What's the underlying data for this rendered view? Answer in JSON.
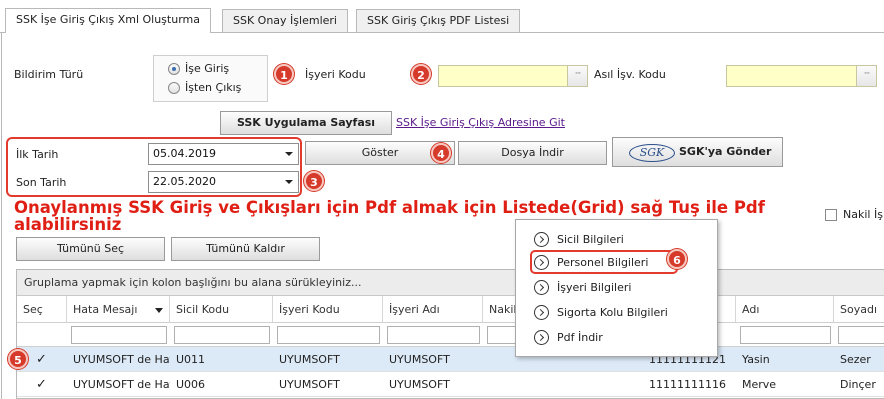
{
  "tabs": [
    {
      "label": "SSK İşe Giriş Çıkış Xml Oluşturma",
      "active": true
    },
    {
      "label": "SSK Onay İşlemleri",
      "active": false
    },
    {
      "label": "SSK Giriş Çıkış PDF Listesi",
      "active": false
    }
  ],
  "form": {
    "bildirim_label": "Bildirim Türü",
    "radio_ise_giris": "İşe Giriş",
    "radio_isten_cikis": "İşten Çıkış",
    "isyeri_kodu_label": "İşyeri Kodu",
    "asil_isv_kodu_label": "Asıl İşv. Kodu",
    "lookup_btn": "···",
    "ssk_page_button": "SSK Uygulama Sayfası",
    "ssk_link": "SSK İşe Giriş Çıkış Adresine Git",
    "ilk_tarih_label": "İlk Tarih",
    "ilk_tarih_value": "05.04.2019",
    "son_tarih_label": "Son Tarih",
    "son_tarih_value": "22.05.2020",
    "goster_button": "Göster",
    "dosya_indir_button": "Dosya İndir",
    "sgk_logo": "SGK",
    "sgk_gonder_button": "SGK'ya Gönder"
  },
  "badges": [
    "1",
    "2",
    "3",
    "4",
    "5",
    "6"
  ],
  "headline": "Onaylanmış SSK Giriş ve Çıkışları için Pdf almak için Listede(Grid) sağ Tuş ile Pdf alabilirsiniz",
  "nakil_checkbox_label": "Nakil İş",
  "select_all_button": "Tümünü Seç",
  "deselect_all_button": "Tümünü Kaldır",
  "grid": {
    "group_hint": "Gruplama yapmak için kolon başlığını bu alana sürükleyiniz...",
    "columns": [
      "Seç",
      "Hata Mesajı",
      "Sicil Kodu",
      "İşyeri Kodu",
      "İşyeri Adı",
      "Nakil",
      "",
      "Adı",
      "Soyadı"
    ],
    "rows": [
      {
        "hata": "UYUMSOFT de Hat",
        "sicil": "U011",
        "isyeri_kodu": "UYUMSOFT",
        "isyeri_adi": "UYUMSOFT",
        "tc": "11111111121",
        "adi": "Yasin",
        "soyadi": "Sezer",
        "selected": true
      },
      {
        "hata": "UYUMSOFT de Hat",
        "sicil": "U006",
        "isyeri_kodu": "UYUMSOFT",
        "isyeri_adi": "UYUMSOFT",
        "tc": "11111111116",
        "adi": "Merve",
        "soyadi": "Dinçer",
        "selected": false
      }
    ]
  },
  "context_menu": {
    "items": [
      "Sicil Bilgileri",
      "Personel Bilgileri",
      "İşyeri Bilgileri",
      "Sigorta Kolu Bilgileri",
      "Pdf İndir"
    ]
  },
  "colors": {
    "accent_red": "#e23b2e",
    "lookup_bg": "#ffffc8",
    "selected_row": "#dce9f7"
  }
}
